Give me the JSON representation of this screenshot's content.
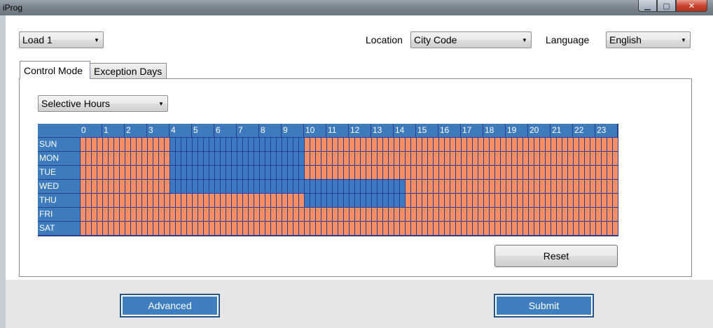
{
  "window": {
    "title": "iProg",
    "min_glyph": "▁",
    "max_glyph": "▢",
    "close_glyph": "✕"
  },
  "toolbar": {
    "load": {
      "value": "Load 1"
    },
    "location_label": "Location",
    "location": {
      "value": "City Code"
    },
    "language_label": "Language",
    "language": {
      "value": "English"
    }
  },
  "tabs": [
    {
      "label": "Control Mode",
      "active": true
    },
    {
      "label": "Exception Days",
      "active": false
    }
  ],
  "mode": {
    "value": "Selective Hours"
  },
  "schedule": {
    "hours": [
      "0",
      "1",
      "2",
      "3",
      "4",
      "5",
      "6",
      "7",
      "8",
      "9",
      "10",
      "11",
      "12",
      "13",
      "14",
      "15",
      "16",
      "17",
      "18",
      "19",
      "20",
      "21",
      "22",
      "23"
    ],
    "days": [
      "SUN",
      "MON",
      "TUE",
      "WED",
      "THU",
      "FRI",
      "SAT"
    ],
    "slots_per_hour": 4,
    "selected_ranges": [
      {
        "day": "SUN",
        "from_hour": 4,
        "to_hour": 10
      },
      {
        "day": "MON",
        "from_hour": 4,
        "to_hour": 10
      },
      {
        "day": "TUE",
        "from_hour": 4,
        "to_hour": 10
      },
      {
        "day": "WED",
        "from_hour": 4,
        "to_hour": 14.5
      },
      {
        "day": "THU",
        "from_hour": 10,
        "to_hour": 14.5
      }
    ],
    "colors": {
      "selected": "#3b79c3",
      "unselected": "#f68f67",
      "header": "#3d7bbd",
      "gridline": "#2b3f8f"
    }
  },
  "buttons": {
    "reset": "Reset",
    "advanced": "Advanced",
    "submit": "Submit"
  },
  "icons": {
    "dropdown": "▼"
  }
}
